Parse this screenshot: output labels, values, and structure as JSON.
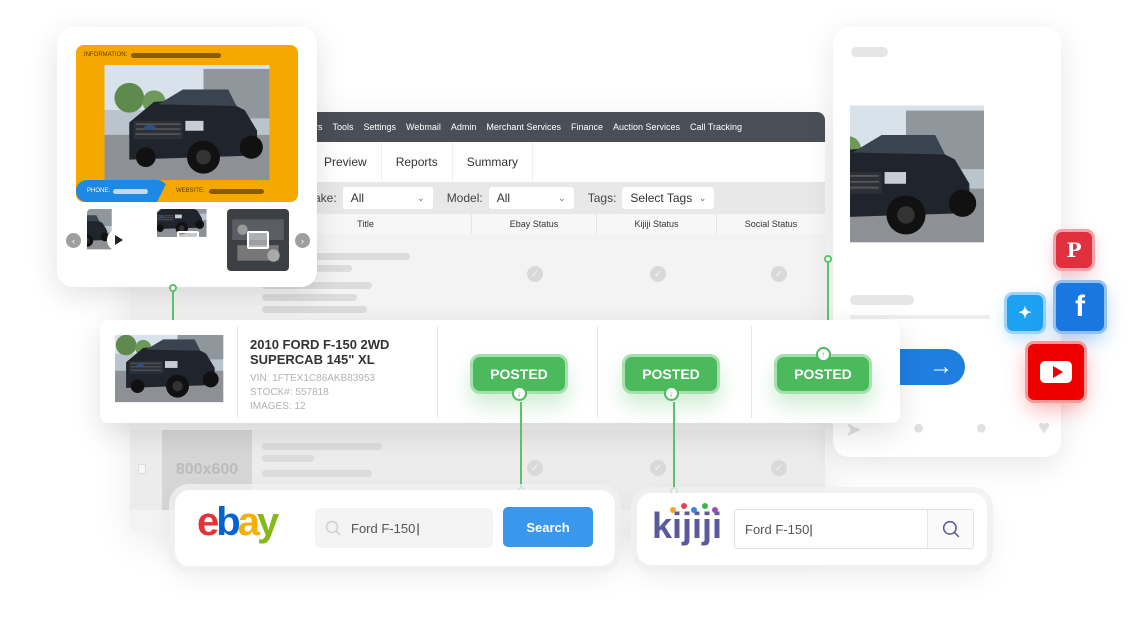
{
  "admin": {
    "nav": [
      "rs",
      "Tools",
      "Settings",
      "Webmail",
      "Admin",
      "Merchant Services",
      "Finance",
      "Auction Services",
      "Call Tracking"
    ],
    "tabs": [
      "Preview",
      "Reports",
      "Summary"
    ],
    "filters": {
      "make_label": "ake:",
      "make_value": "All",
      "model_label": "Model:",
      "model_value": "All",
      "tags_label": "Tags:",
      "tags_value": "Select Tags"
    },
    "columns": [
      "Title",
      "Ebay Status",
      "Kijiji Status",
      "Social Status"
    ],
    "placeholder_image_label": "800x600"
  },
  "gallery": {
    "info_label": "INFORMATION:",
    "phone_label": "PHONE:",
    "website_label": "WEBSITE:",
    "thumbs": [
      "video",
      "image",
      "image"
    ]
  },
  "listing": {
    "title": "2010 FORD F-150 2WD SUPERCAB 145\" XL",
    "vin": "VIN: 1FTEX1C86AKB83953",
    "stock": "STOCK#: 557818",
    "images": "IMAGES: 12",
    "ebay_status": "POSTED",
    "kijiji_status": "POSTED",
    "social_status": "POSTED"
  },
  "ebay": {
    "logo": [
      "e",
      "b",
      "a",
      "y"
    ],
    "logo_colors": [
      "#e53238",
      "#0064d2",
      "#f5af02",
      "#86b817"
    ],
    "search_value": "Ford F-150",
    "search_button": "Search"
  },
  "kijiji": {
    "logo": "kijiji",
    "search_value": "Ford F-150"
  },
  "social": {
    "icons": [
      "pinterest",
      "twitter",
      "facebook",
      "youtube"
    ],
    "colors": {
      "pinterest": "#e0303e",
      "twitter": "#1da1f2",
      "facebook": "#1877e0",
      "youtube": "#ee0000"
    }
  },
  "colors": {
    "posted_green": "#4cba5c",
    "nav_dark": "#4a4f57",
    "info_orange": "#f5a800",
    "phone_blue": "#1e88e5",
    "search_blue": "#3a97ec"
  }
}
